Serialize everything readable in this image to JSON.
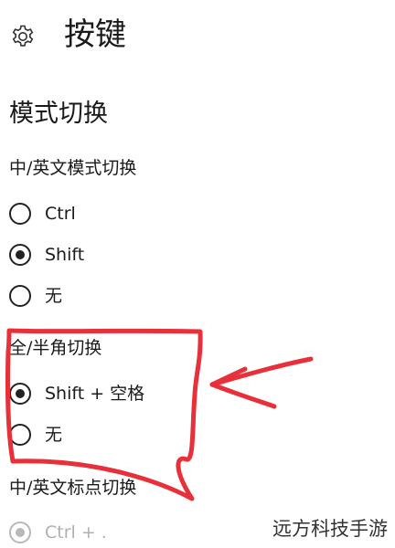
{
  "header": {
    "settings_icon": "gear-icon",
    "title": "按键"
  },
  "section": {
    "title": "模式切换"
  },
  "groups": [
    {
      "label": "中/英文模式切换",
      "options": [
        {
          "label": "Ctrl",
          "checked": false,
          "disabled": false
        },
        {
          "label": "Shift",
          "checked": true,
          "disabled": false
        },
        {
          "label": "无",
          "checked": false,
          "disabled": false
        }
      ]
    },
    {
      "label": "全/半角切换",
      "options": [
        {
          "label": "Shift + 空格",
          "checked": true,
          "disabled": false
        },
        {
          "label": "无",
          "checked": false,
          "disabled": false
        }
      ]
    },
    {
      "label": "中/英文标点切换",
      "options": [
        {
          "label": "Ctrl + .",
          "checked": true,
          "disabled": true
        }
      ]
    }
  ],
  "annotation": {
    "color": "#e8303a"
  },
  "watermark": {
    "text": "远方科技手游"
  }
}
